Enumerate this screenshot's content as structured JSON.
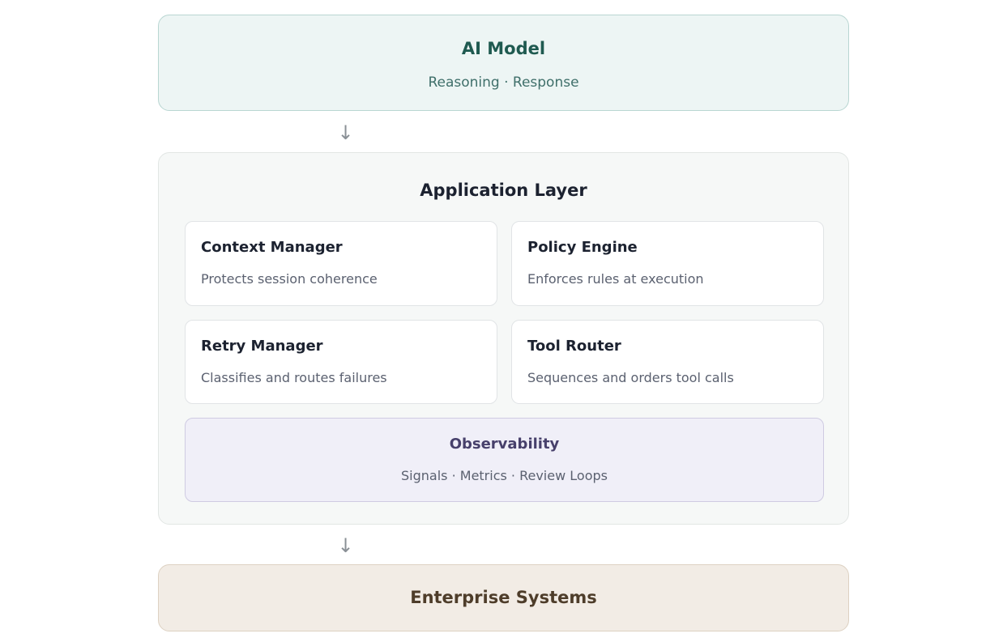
{
  "ai_model": {
    "title": "AI Model",
    "subtitle": "Reasoning · Response"
  },
  "arrows": {
    "symbol": "↓"
  },
  "application_layer": {
    "title": "Application Layer",
    "cards": [
      {
        "title": "Context Manager",
        "description": "Protects session coherence"
      },
      {
        "title": "Policy Engine",
        "description": "Enforces rules at execution"
      },
      {
        "title": "Retry Manager",
        "description": "Classifies and routes failures"
      },
      {
        "title": "Tool Router",
        "description": "Sequences and orders tool calls"
      }
    ],
    "observability": {
      "title": "Observability",
      "subtitle": "Signals · Metrics · Review Loops"
    }
  },
  "enterprise_systems": {
    "title": "Enterprise Systems"
  },
  "colors": {
    "ai_bg": "#edf5f4",
    "ai_accent": "#1f5a50",
    "app_bg": "#f6f8f7",
    "observability_bg": "#f0eff8",
    "observability_accent": "#47406b",
    "enterprise_bg": "#f2ece5",
    "enterprise_accent": "#4e3d2a"
  }
}
